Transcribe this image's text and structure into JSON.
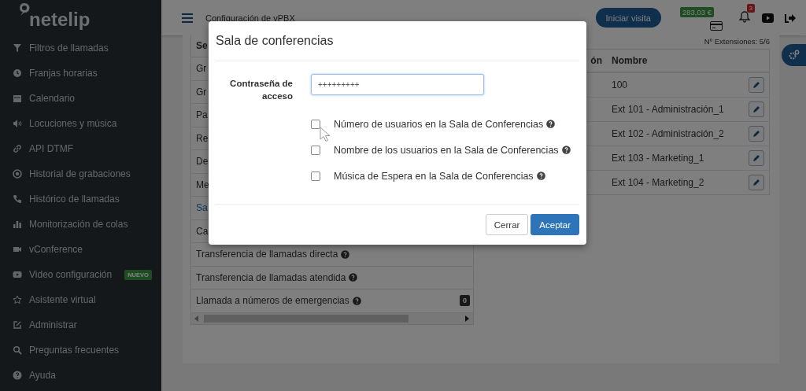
{
  "sidebar": {
    "logo": "netelip",
    "items": [
      {
        "label": "Filtros de llamadas",
        "kind": "filter"
      },
      {
        "label": "Franjas horarias",
        "kind": "clock"
      },
      {
        "label": "Calendario",
        "kind": "calendar"
      },
      {
        "label": "Locuciones y música",
        "kind": "speaker"
      },
      {
        "label": "API DTMF",
        "kind": "link"
      },
      {
        "label": "Historial de grabaciones",
        "kind": "record"
      },
      {
        "label": "Histórico de llamadas",
        "kind": "phone"
      },
      {
        "label": "Monitorización de colas",
        "kind": "chart"
      },
      {
        "label": "vConference",
        "kind": "video"
      },
      {
        "label": "Video configuración",
        "kind": "play",
        "badge": "NUEVO"
      },
      {
        "label": "Asistente virtual",
        "kind": "star"
      },
      {
        "label": "Administrar",
        "kind": "edit"
      },
      {
        "label": "Preguntas frecuentes",
        "kind": "search"
      },
      {
        "label": "Ayuda",
        "kind": "help"
      }
    ]
  },
  "header": {
    "title": "Configuración de vPBX",
    "visit_button": "Iniciar visita",
    "balance": "283,03 €",
    "notifications": "3"
  },
  "extensions_count": "Nº Extensiones: 5/6",
  "settings_list": {
    "header": "Se",
    "rows": [
      {
        "label": "Gr",
        "selected": false
      },
      {
        "label": "Gr",
        "selected": false
      },
      {
        "label": "Pa",
        "selected": false
      },
      {
        "label": "Re",
        "selected": false
      },
      {
        "label": "De",
        "selected": false
      },
      {
        "label": "Me",
        "selected": false
      },
      {
        "label": "Sa",
        "selected": true
      },
      {
        "label": "Ca",
        "selected": false
      },
      {
        "label": "Transferencia de llamadas directa",
        "selected": false,
        "help": true
      },
      {
        "label": "Transferencia de llamadas atendida",
        "selected": false,
        "help": true
      },
      {
        "label": "Llamada a números de emergencias",
        "selected": false,
        "help": true,
        "value": "0"
      }
    ]
  },
  "extensions_table": {
    "columns": [
      "ón",
      "Nombre"
    ],
    "rows": [
      {
        "name": "100"
      },
      {
        "name": "Ext 101 - Administración_1"
      },
      {
        "name": "Ext 102 - Administración_2"
      },
      {
        "name": "Ext 103 - Marketing_1"
      },
      {
        "name": "Ext 104 - Marketing_2"
      }
    ]
  },
  "modal": {
    "title": "Sala de conferencias",
    "password_label": "Contraseña de acceso",
    "password_value": "+++++++++",
    "options": [
      {
        "label": "Número de usuarios en la Sala de Conferencias",
        "checked": false
      },
      {
        "label": "Nombre de los usuarios en la Sala de Conferencias",
        "checked": false
      },
      {
        "label": "Música de Espera en la Sala de Conferencias",
        "checked": false
      }
    ],
    "buttons": [
      {
        "label": "Cerrar",
        "kind": "secondary"
      },
      {
        "label": "Aceptar",
        "kind": "primary"
      }
    ]
  }
}
